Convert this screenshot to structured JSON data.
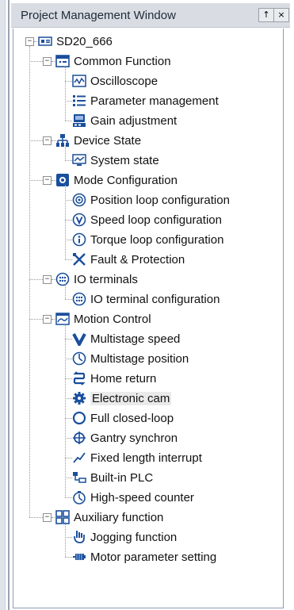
{
  "window": {
    "title": "Project Management Window",
    "pin_label": "↑",
    "close_label": "×"
  },
  "tree": {
    "root": {
      "label": "SD20_666",
      "icon": "device-root-icon"
    },
    "groups": [
      {
        "label": "Common Function",
        "icon": "common-function-icon",
        "items": [
          {
            "label": "Oscilloscope",
            "icon": "oscilloscope-icon"
          },
          {
            "label": "Parameter management",
            "icon": "list-icon"
          },
          {
            "label": "Gain adjustment",
            "icon": "gain-icon"
          }
        ]
      },
      {
        "label": "Device State",
        "icon": "network-icon",
        "items": [
          {
            "label": "System state",
            "icon": "system-state-icon"
          }
        ]
      },
      {
        "label": "Mode Configuration",
        "icon": "mode-config-icon",
        "items": [
          {
            "label": "Position loop configuration",
            "icon": "position-loop-icon"
          },
          {
            "label": "Speed loop configuration",
            "icon": "speed-loop-icon"
          },
          {
            "label": "Torque loop configuration",
            "icon": "torque-loop-icon"
          },
          {
            "label": "Fault & Protection",
            "icon": "fault-protection-icon"
          }
        ]
      },
      {
        "label": "IO terminals",
        "icon": "io-terminal-icon",
        "items": [
          {
            "label": "IO terminal configuration",
            "icon": "io-terminal-icon"
          }
        ]
      },
      {
        "label": "Motion Control",
        "icon": "motion-control-icon",
        "items": [
          {
            "label": "Multistage speed",
            "icon": "multistage-speed-icon"
          },
          {
            "label": "Multistage position",
            "icon": "multistage-position-icon"
          },
          {
            "label": "Home return",
            "icon": "home-return-icon"
          },
          {
            "label": "Electronic cam",
            "icon": "gear-icon",
            "selected": true
          },
          {
            "label": "Full closed-loop",
            "icon": "closed-loop-icon"
          },
          {
            "label": "Gantry synchron",
            "icon": "gantry-icon"
          },
          {
            "label": "Fixed length interrupt",
            "icon": "fixed-length-icon"
          },
          {
            "label": "Built-in PLC",
            "icon": "plc-icon"
          },
          {
            "label": "High-speed counter",
            "icon": "counter-icon"
          }
        ]
      },
      {
        "label": "Auxiliary function",
        "icon": "auxiliary-icon",
        "items": [
          {
            "label": "Jogging function",
            "icon": "jogging-icon"
          },
          {
            "label": "Motor parameter setting",
            "icon": "motor-icon"
          }
        ]
      }
    ]
  },
  "colors": {
    "accent": "#1a4f9c",
    "selected_bg": "#eaeaea",
    "titlebar": "#d9dde3"
  }
}
